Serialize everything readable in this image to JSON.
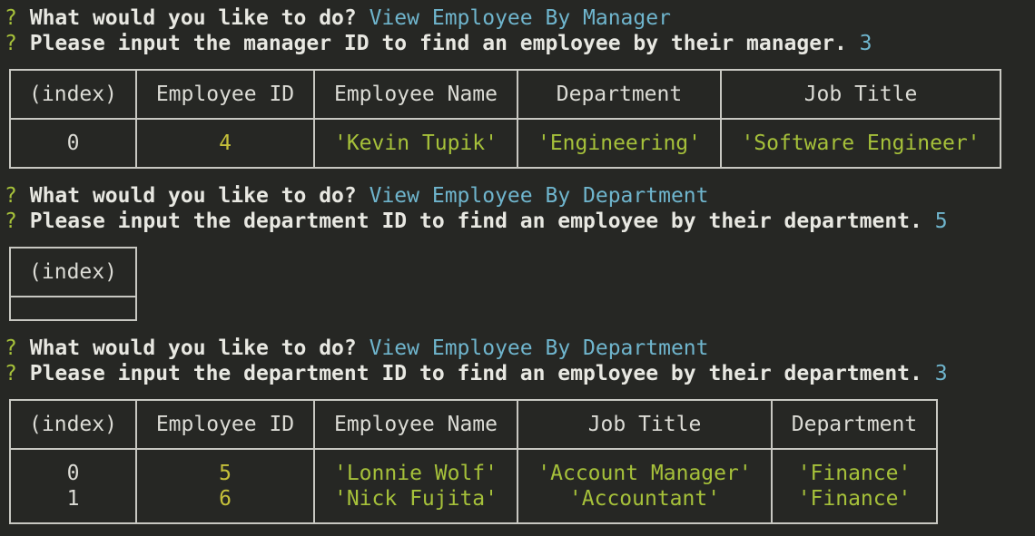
{
  "prompts": [
    {
      "q_mark": "?",
      "question": "What would you like to do?",
      "answer": "View Employee By Manager"
    },
    {
      "q_mark": "?",
      "question": "Please input the manager ID to find an employee by their manager.",
      "answer": "3"
    },
    {
      "q_mark": "?",
      "question": "What would you like to do?",
      "answer": "View Employee By Department"
    },
    {
      "q_mark": "?",
      "question": "Please input the department ID to find an employee by their department.",
      "answer": "5"
    },
    {
      "q_mark": "?",
      "question": "What would you like to do?",
      "answer": "View Employee By Department"
    },
    {
      "q_mark": "?",
      "question": "Please input the department ID to find an employee by their department.",
      "answer": "3"
    }
  ],
  "table1": {
    "headers": [
      "(index)",
      "Employee ID",
      "Employee Name",
      "Department",
      "Job Title"
    ],
    "rows": [
      {
        "index": "0",
        "id": "4",
        "name": "'Kevin Tupik'",
        "dept": "'Engineering'",
        "title": "'Software Engineer'"
      }
    ]
  },
  "table2": {
    "headers": [
      "(index)"
    ]
  },
  "table3": {
    "headers": [
      "(index)",
      "Employee ID",
      "Employee Name",
      "Job Title",
      "Department"
    ],
    "rows": [
      {
        "index": "0",
        "id": "5",
        "name": "'Lonnie Wolf'",
        "title": "'Account Manager'",
        "dept": "'Finance'"
      },
      {
        "index": "1",
        "id": "6",
        "name": "'Nick Fujita'",
        "title": "'Accountant'",
        "dept": "'Finance'"
      }
    ]
  }
}
